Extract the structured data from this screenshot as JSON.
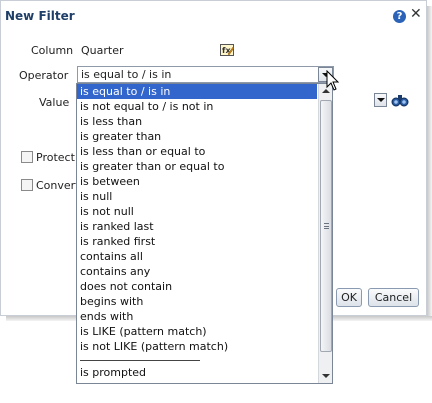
{
  "dialog": {
    "title": "New Filter",
    "help_icon": "?",
    "close_icon": "✕"
  },
  "form": {
    "column_label": "Column",
    "column_value": "Quarter",
    "operator_label": "Operator",
    "operator_value": "is equal to / is in",
    "value_label": "Value",
    "protect_label": "Protect f",
    "convert_label": "Convert"
  },
  "buttons": {
    "ok": "OK",
    "cancel": "Cancel"
  },
  "dropdown": {
    "options": [
      "is equal to / is in",
      "is not equal to / is not in",
      "is less than",
      "is greater than",
      "is less than or equal to",
      "is greater than or equal to",
      "is between",
      "is null",
      "is not null",
      "is ranked last",
      "is ranked first",
      "contains all",
      "contains any",
      "does not contain",
      "begins with",
      "ends with",
      "is LIKE (pattern match)",
      "is not LIKE (pattern match)"
    ],
    "prompted": "is prompted"
  },
  "colors": {
    "title": "#1f3f68",
    "selection": "#3366cc",
    "help_icon": "#2a63b7"
  },
  "icons": [
    "help-icon",
    "close-icon",
    "edit-icon",
    "dropdown-arrow-icon",
    "search-icon",
    "mouse-cursor-icon"
  ]
}
